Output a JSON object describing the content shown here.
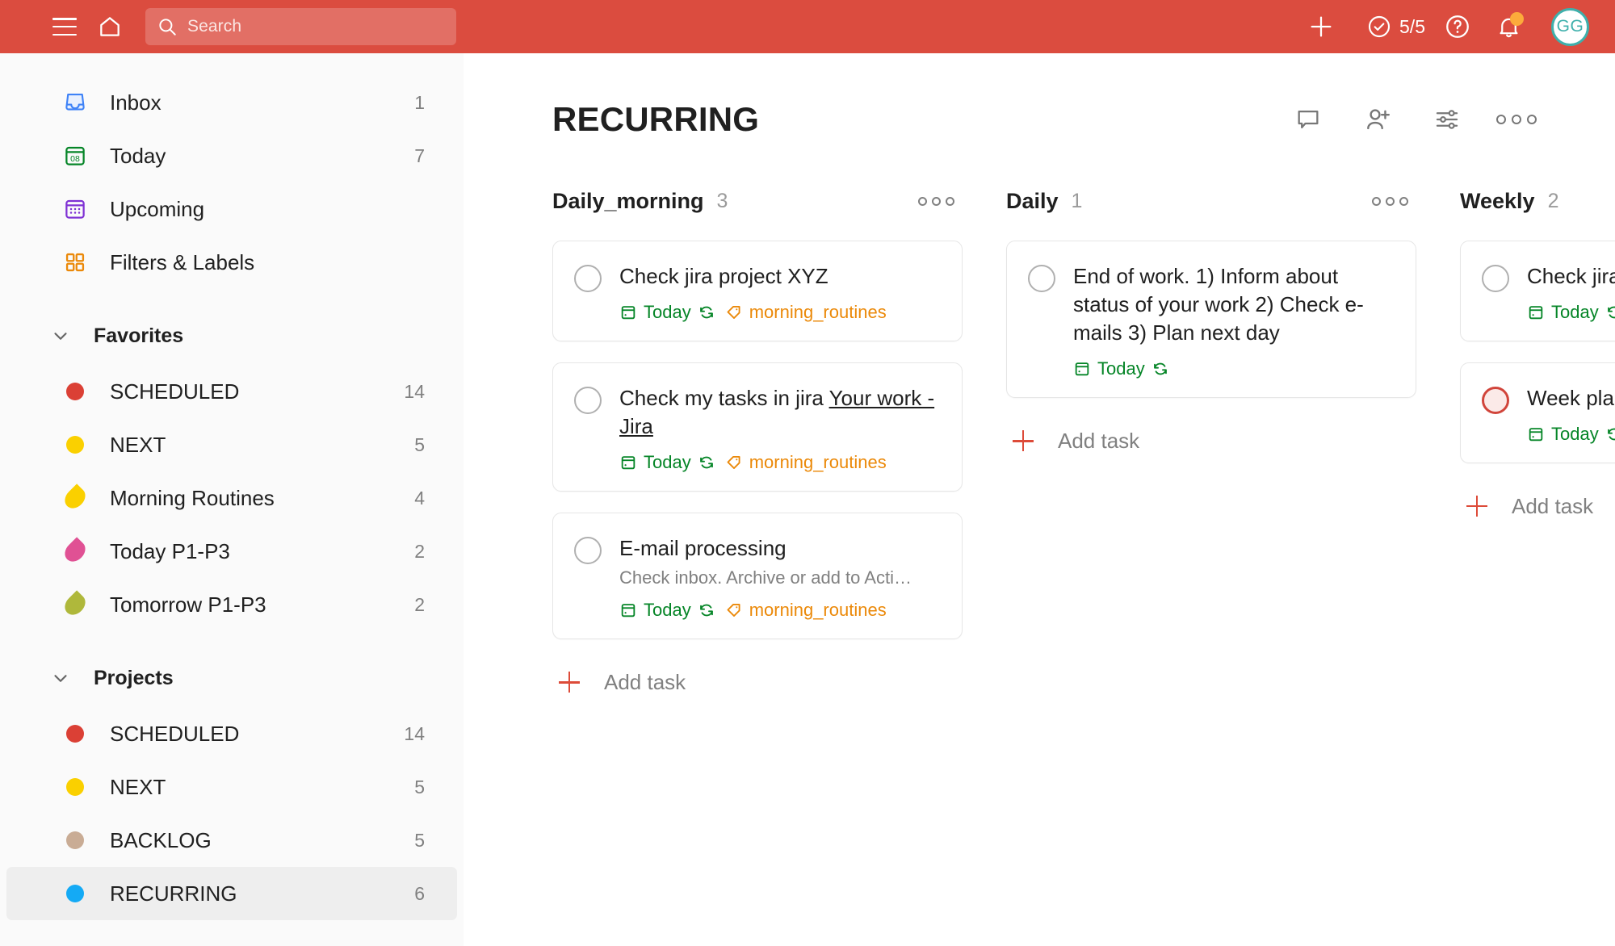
{
  "topbar": {
    "menu_icon": "hamburger-icon",
    "home_icon": "home-icon",
    "search_placeholder": "Search",
    "add_icon": "plus-icon",
    "karma_icon": "check-circle-icon",
    "karma_value": "5/5",
    "help_icon": "question-circle-icon",
    "notifications_icon": "bell-icon",
    "avatar_initials": "GG",
    "background_color": "#db4c3f",
    "avatar_accent_color": "#3fb0ac",
    "badge_color": "#fcab3b"
  },
  "sidebar": {
    "nav": [
      {
        "label": "Inbox",
        "count": "1",
        "icon": "inbox-icon",
        "color": "#3e82f7"
      },
      {
        "label": "Today",
        "count": "7",
        "icon": "calendar-today-icon",
        "color": "#058527"
      },
      {
        "label": "Upcoming",
        "count": "",
        "icon": "calendar-upcoming-icon",
        "color": "#7f31d4"
      },
      {
        "label": "Filters & Labels",
        "count": "",
        "icon": "filters-labels-icon",
        "color": "#eb8909"
      }
    ],
    "favorites": {
      "title": "Favorites",
      "chevron_icon": "chevron-down-icon",
      "items": [
        {
          "label": "SCHEDULED",
          "count": "14",
          "shape": "dot",
          "color": "#db4035"
        },
        {
          "label": "NEXT",
          "count": "5",
          "shape": "dot",
          "color": "#fad000"
        },
        {
          "label": "Morning Routines",
          "count": "4",
          "shape": "drop",
          "color": "#fad000"
        },
        {
          "label": "Today P1-P3",
          "count": "2",
          "shape": "drop",
          "color": "#e05194"
        },
        {
          "label": "Tomorrow P1-P3",
          "count": "2",
          "shape": "drop",
          "color": "#afb83b"
        }
      ]
    },
    "projects": {
      "title": "Projects",
      "chevron_icon": "chevron-down-icon",
      "items": [
        {
          "label": "SCHEDULED",
          "count": "14",
          "shape": "dot",
          "color": "#db4035",
          "active": false
        },
        {
          "label": "NEXT",
          "count": "5",
          "shape": "dot",
          "color": "#fad000",
          "active": false
        },
        {
          "label": "BACKLOG",
          "count": "5",
          "shape": "dot",
          "color": "#c9ac95",
          "active": false
        },
        {
          "label": "RECURRING",
          "count": "6",
          "shape": "dot",
          "color": "#14aaf5",
          "active": true
        }
      ]
    }
  },
  "main": {
    "page_title": "RECURRING",
    "tools": [
      {
        "name": "comments-icon"
      },
      {
        "name": "add-person-icon"
      },
      {
        "name": "view-options-icon"
      },
      {
        "name": "more-menu-icon"
      }
    ],
    "add_task_label": "Add task",
    "columns": [
      {
        "name": "Daily_morning",
        "count": "3",
        "menu_icon": "more-menu-icon",
        "show_add_task": true,
        "tasks": [
          {
            "title": "Check jira project XYZ",
            "link_text": "",
            "description": "",
            "due": "Today",
            "due_icon": "calendar-icon",
            "recurring_icon": "recurring-icon",
            "tag": "morning_routines",
            "tag_icon": "tag-icon",
            "priority": "none"
          },
          {
            "title": "Check my tasks in jira ",
            "link_text": "Your work - Jira",
            "description": "",
            "due": "Today",
            "due_icon": "calendar-icon",
            "recurring_icon": "recurring-icon",
            "tag": "morning_routines",
            "tag_icon": "tag-icon",
            "priority": "none"
          },
          {
            "title": "E-mail processing",
            "link_text": "",
            "description": "Check inbox. Archive or add to Acti…",
            "due": "Today",
            "due_icon": "calendar-icon",
            "recurring_icon": "recurring-icon",
            "tag": "morning_routines",
            "tag_icon": "tag-icon",
            "priority": "none"
          }
        ]
      },
      {
        "name": "Daily",
        "count": "1",
        "menu_icon": "more-menu-icon",
        "show_add_task": true,
        "tasks": [
          {
            "title": "End of work. 1) Inform about status of your work 2) Check e-mails 3) Plan next day",
            "link_text": "",
            "description": "",
            "due": "Today",
            "due_icon": "calendar-icon",
            "recurring_icon": "recurring-icon",
            "tag": "",
            "tag_icon": "",
            "priority": "none"
          }
        ]
      },
      {
        "name": "Weekly",
        "count": "2",
        "menu_icon": "",
        "show_add_task": true,
        "tasks": [
          {
            "title": "Check jira project ABC",
            "link_text": "",
            "description": "",
            "due": "Today",
            "due_icon": "calendar-icon",
            "recurring_icon": "recurring-icon",
            "tag": "",
            "tag_icon": "",
            "priority": "none"
          },
          {
            "title": "Week planning",
            "link_text": "",
            "description": "",
            "due": "Today",
            "due_icon": "calendar-icon",
            "recurring_icon": "recurring-icon",
            "tag": "",
            "tag_icon": "",
            "priority": "p1"
          }
        ]
      }
    ]
  },
  "colors": {
    "brand_red": "#db4c3f",
    "due_green": "#058527",
    "tag_orange": "#eb8909",
    "priority_red": "#d1453b",
    "muted_text": "#808080"
  }
}
